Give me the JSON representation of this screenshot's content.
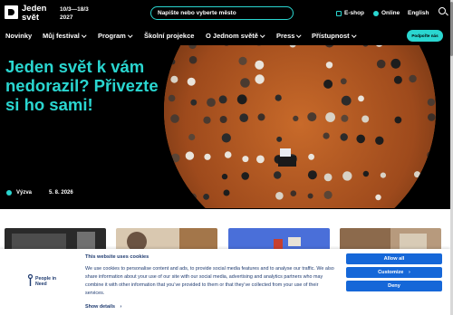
{
  "brand": {
    "name": "Jeden svět",
    "dates": "10/3—18/3 2027"
  },
  "header": {
    "search_placeholder": "Napište nebo vyberte město",
    "eshop_label": "E-shop",
    "online_label": "Online",
    "language_label": "English"
  },
  "nav": {
    "items": [
      {
        "label": "Novinky",
        "has_menu": false
      },
      {
        "label": "Můj festival",
        "has_menu": true
      },
      {
        "label": "Program",
        "has_menu": true
      },
      {
        "label": "Školní projekce",
        "has_menu": false
      },
      {
        "label": "O Jednom světě",
        "has_menu": true
      },
      {
        "label": "Press",
        "has_menu": true
      },
      {
        "label": "Přístupnost",
        "has_menu": true
      }
    ],
    "donate_label": "Podpořte nás"
  },
  "hero": {
    "title": "Jeden svět k vám nedorazil? Přivezte si ho sami!",
    "category": "Výzva",
    "date": "5. 8. 2026"
  },
  "cookie": {
    "org_name": "People in Need",
    "title": "This website uses cookies",
    "body": "We use cookies to personalise content and ads, to provide social media features and to analyse our traffic. We also share information about your use of our site with our social media, advertising and analytics partners who may combine it with other information that you’ve provided to them or that they’ve collected from your use of their services.",
    "details_label": "Show details",
    "allow_all_label": "Allow all",
    "customize_label": "Customize",
    "deny_label": "Deny"
  },
  "colors": {
    "accent": "#2ad6d0",
    "cookie_text": "#1f3b70",
    "cookie_button": "#1567d8"
  }
}
